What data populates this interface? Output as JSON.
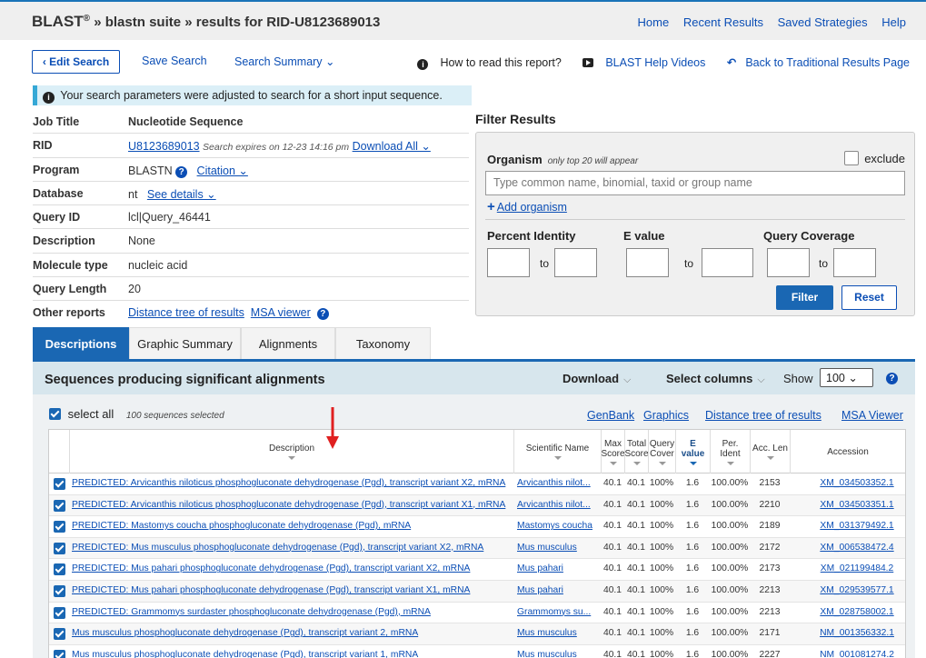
{
  "header": {
    "brand": "BLAST",
    "reg": "®",
    "breadcrumb": " » blastn suite » results for RID-U8123689013",
    "nav": [
      "Home",
      "Recent Results",
      "Saved Strategies",
      "Help"
    ]
  },
  "toolbar": {
    "edit_search": "‹ Edit Search",
    "save_search": "Save Search",
    "search_summary": "Search Summary ⌄",
    "how_to_read": "How to read this report?",
    "help_videos": "BLAST Help Videos",
    "back_traditional": "Back to Traditional Results Page"
  },
  "notice": "Your search parameters were adjusted to search for a short input sequence.",
  "job": {
    "job_title_label": "Job Title",
    "job_title": "Nucleotide Sequence",
    "rid_label": "RID",
    "rid": "U8123689013",
    "rid_expires": "Search expires on 12-23 14:16 pm",
    "download_all": "Download All ⌄",
    "program_label": "Program",
    "program": "BLASTN",
    "citation": "Citation ⌄",
    "database_label": "Database",
    "database": "nt",
    "see_details": "See details ⌄",
    "query_id_label": "Query ID",
    "query_id": "lcl|Query_46441",
    "description_label": "Description",
    "description": "None",
    "molecule_label": "Molecule type",
    "molecule": "nucleic acid",
    "query_len_label": "Query Length",
    "query_len": "20",
    "other_reports_label": "Other reports",
    "distance_tree": "Distance tree of results",
    "msa_viewer": "MSA viewer"
  },
  "filter": {
    "title": "Filter Results",
    "organism_label": "Organism",
    "organism_hint": "only top 20 will appear",
    "exclude": "exclude",
    "organism_placeholder": "Type common  name, binomial, taxid or group  name",
    "add_organism": "Add organism",
    "percent_identity": "Percent Identity",
    "e_value": "E value",
    "query_coverage": "Query Coverage",
    "to": "to",
    "filter_btn": "Filter",
    "reset_btn": "Reset"
  },
  "tabs": [
    "Descriptions",
    "Graphic Summary",
    "Alignments",
    "Taxonomy"
  ],
  "results": {
    "title": "Sequences producing significant alignments",
    "download": "Download",
    "select_columns": "Select columns",
    "show": "Show",
    "show_value": "100 ⌄",
    "select_all": "select all",
    "selected_count": "100 sequences selected",
    "links": [
      "GenBank",
      "Graphics",
      "Distance tree of results",
      "MSA Viewer"
    ],
    "columns": {
      "description": "Description",
      "scientific": "Scientific Name",
      "max1": "Max",
      "max2": "Score",
      "total1": "Total",
      "total2": "Score",
      "qc1": "Query",
      "qc2": "Cover",
      "e1": "E",
      "e2": "value",
      "pi1": "Per.",
      "pi2": "Ident",
      "acclen": "Acc. Len",
      "accession": "Accession"
    },
    "rows": [
      {
        "desc": "PREDICTED: Arvicanthis niloticus phosphogluconate dehydrogenase (Pgd), transcript variant X2, mRNA",
        "sci": "Arvicanthis nilot...",
        "max": "40.1",
        "total": "40.1",
        "qc": "100%",
        "e": "1.6",
        "pi": "100.00%",
        "len": "2153",
        "acc": "XM_034503352.1"
      },
      {
        "desc": "PREDICTED: Arvicanthis niloticus phosphogluconate dehydrogenase (Pgd), transcript variant X1, mRNA",
        "sci": "Arvicanthis nilot...",
        "max": "40.1",
        "total": "40.1",
        "qc": "100%",
        "e": "1.6",
        "pi": "100.00%",
        "len": "2210",
        "acc": "XM_034503351.1"
      },
      {
        "desc": "PREDICTED: Mastomys coucha phosphogluconate dehydrogenase (Pgd), mRNA",
        "sci": "Mastomys coucha",
        "max": "40.1",
        "total": "40.1",
        "qc": "100%",
        "e": "1.6",
        "pi": "100.00%",
        "len": "2189",
        "acc": "XM_031379492.1"
      },
      {
        "desc": "PREDICTED: Mus musculus phosphogluconate dehydrogenase (Pgd), transcript variant X2, mRNA",
        "sci": "Mus musculus",
        "max": "40.1",
        "total": "40.1",
        "qc": "100%",
        "e": "1.6",
        "pi": "100.00%",
        "len": "2172",
        "acc": "XM_006538472.4"
      },
      {
        "desc": "PREDICTED: Mus pahari phosphogluconate dehydrogenase (Pgd), transcript variant X2, mRNA",
        "sci": "Mus pahari",
        "max": "40.1",
        "total": "40.1",
        "qc": "100%",
        "e": "1.6",
        "pi": "100.00%",
        "len": "2173",
        "acc": "XM_021199484.2"
      },
      {
        "desc": "PREDICTED: Mus pahari phosphogluconate dehydrogenase (Pgd), transcript variant X1, mRNA",
        "sci": "Mus pahari",
        "max": "40.1",
        "total": "40.1",
        "qc": "100%",
        "e": "1.6",
        "pi": "100.00%",
        "len": "2213",
        "acc": "XM_029539577.1"
      },
      {
        "desc": "PREDICTED: Grammomys surdaster phosphogluconate dehydrogenase (Pgd), mRNA",
        "sci": "Grammomys su...",
        "max": "40.1",
        "total": "40.1",
        "qc": "100%",
        "e": "1.6",
        "pi": "100.00%",
        "len": "2213",
        "acc": "XM_028758002.1"
      },
      {
        "desc": "Mus musculus phosphogluconate dehydrogenase (Pgd), transcript variant 2, mRNA",
        "sci": "Mus musculus",
        "max": "40.1",
        "total": "40.1",
        "qc": "100%",
        "e": "1.6",
        "pi": "100.00%",
        "len": "2171",
        "acc": "NM_001356332.1"
      },
      {
        "desc": "Mus musculus phosphogluconate dehydrogenase (Pgd), transcript variant 1, mRNA",
        "sci": "Mus musculus",
        "max": "40.1",
        "total": "40.1",
        "qc": "100%",
        "e": "1.6",
        "pi": "100.00%",
        "len": "2227",
        "acc": "NM_001081274.2"
      }
    ]
  },
  "colors": {
    "accent": "#1a67b3",
    "link": "#0b4eb5",
    "annotation_arrow": "#e02020"
  },
  "icons": [
    "info-icon",
    "video-icon",
    "back-icon",
    "help-icon",
    "plus-icon",
    "checkbox-icon",
    "sort-arrow-icon",
    "red-arrow-icon"
  ]
}
